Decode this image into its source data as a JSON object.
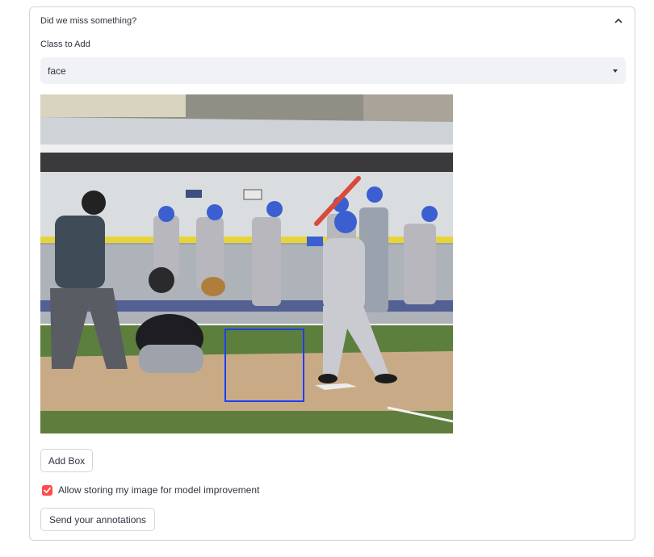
{
  "expander": {
    "title": "Did we miss something?",
    "expanded": true
  },
  "class_select": {
    "label": "Class to Add",
    "value": "face"
  },
  "canvas": {
    "image_alt": "Baseball game: batter at home plate with catcher and umpire, players leaning on dugout fence",
    "annotation_box_color": "#1f3dff"
  },
  "buttons": {
    "add_box": "Add Box",
    "send": "Send your annotations"
  },
  "checkbox": {
    "label": "Allow storing my image for model improvement",
    "checked": true,
    "color": "#ff4b4b"
  }
}
